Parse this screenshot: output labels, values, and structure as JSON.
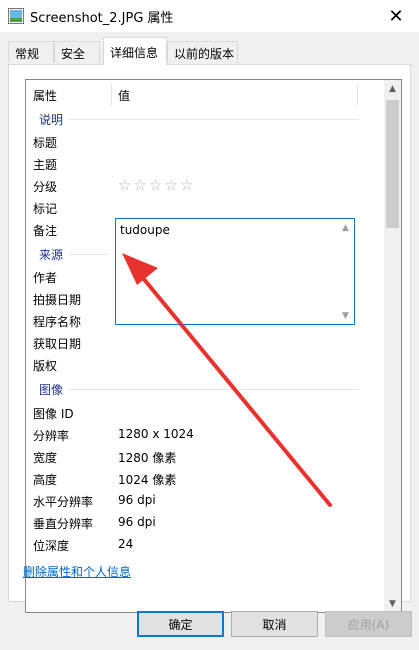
{
  "window": {
    "title": "Screenshot_2.JPG 属性",
    "close_glyph": "✕"
  },
  "tabs": [
    {
      "label": "常规"
    },
    {
      "label": "安全"
    },
    {
      "label": "详细信息"
    },
    {
      "label": "以前的版本"
    }
  ],
  "list": {
    "columns": {
      "property": "属性",
      "value": "值"
    },
    "groups": {
      "description": "说明",
      "origin": "来源",
      "image": "图像"
    },
    "rows": {
      "title": {
        "label": "标题",
        "value": ""
      },
      "subject": {
        "label": "主题",
        "value": ""
      },
      "rating": {
        "label": "分级",
        "value": "",
        "stars": [
          "☆",
          "☆",
          "☆",
          "☆",
          "☆"
        ]
      },
      "tags": {
        "label": "标记",
        "value": ""
      },
      "comments": {
        "label": "备注",
        "value": "tudoupe"
      },
      "authors": {
        "label": "作者",
        "value": ""
      },
      "date_taken": {
        "label": "拍摄日期",
        "value": ""
      },
      "program_name": {
        "label": "程序名称",
        "value": ""
      },
      "date_acquired": {
        "label": "获取日期",
        "value": ""
      },
      "copyright": {
        "label": "版权",
        "value": ""
      },
      "image_id": {
        "label": "图像 ID",
        "value": ""
      },
      "dimensions": {
        "label": "分辨率",
        "value": "1280 x 1024"
      },
      "width": {
        "label": "宽度",
        "value": "1280 像素"
      },
      "height": {
        "label": "高度",
        "value": "1024 像素"
      },
      "h_resolution": {
        "label": "水平分辨率",
        "value": "96 dpi"
      },
      "v_resolution": {
        "label": "垂直分辨率",
        "value": "96 dpi"
      },
      "bit_depth": {
        "label": "位深度",
        "value": "24"
      }
    }
  },
  "scrollbar": {
    "up": "▲",
    "down": "▼"
  },
  "comment_scroll": {
    "up": "▲",
    "down": "▼"
  },
  "remove_link": "删除属性和个人信息",
  "buttons": {
    "ok": "确定",
    "cancel": "取消",
    "apply": "应用(A)"
  },
  "colors": {
    "accent": "#0078d7",
    "group_text": "#1e3287",
    "link": "#0066cc",
    "annotation_arrow": "#e8322e"
  }
}
